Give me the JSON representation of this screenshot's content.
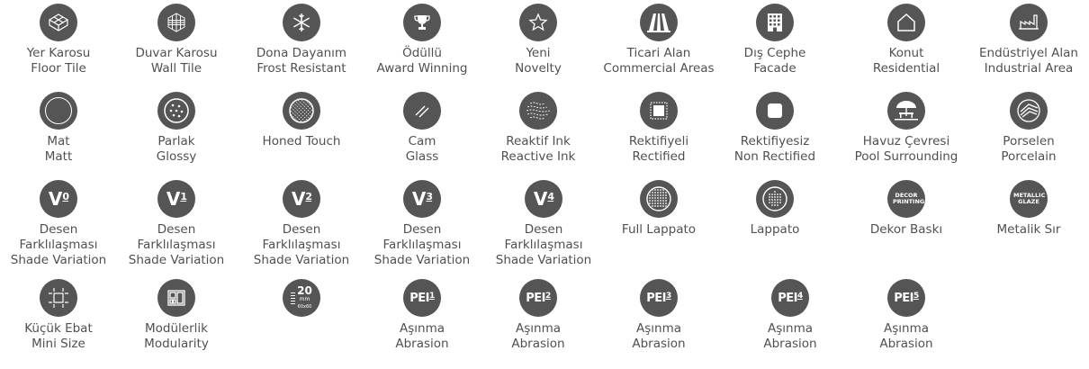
{
  "items": [
    {
      "name": "floor-tile",
      "icon": "floor-tile-icon",
      "l1": "Yer Karosu",
      "l2": "Floor Tile"
    },
    {
      "name": "wall-tile",
      "icon": "wall-tile-icon",
      "l1": "Duvar Karosu",
      "l2": "Wall Tile"
    },
    {
      "name": "frost-resistant",
      "icon": "snowflake-icon",
      "l1": "Dona Dayanım",
      "l2": "Frost Resistant"
    },
    {
      "name": "award-winning",
      "icon": "trophy-icon",
      "l1": "Ödüllü",
      "l2": "Award Winning"
    },
    {
      "name": "novelty",
      "icon": "star-icon",
      "l1": "Yeni",
      "l2": "Novelty"
    },
    {
      "name": "commercial-areas",
      "icon": "commercial-area-icon",
      "l1": "Ticari Alan",
      "l2": "Commercial Areas"
    },
    {
      "name": "facade",
      "icon": "building-icon",
      "l1": "Dış Cephe",
      "l2": "Facade"
    },
    {
      "name": "residential",
      "icon": "house-icon",
      "l1": "Konut",
      "l2": "Residential"
    },
    {
      "name": "industrial-area",
      "icon": "factory-icon",
      "l1": "Endüstriyel Alan",
      "l2": "Industrial Area"
    },
    {
      "name": "matt",
      "icon": "matt-icon",
      "l1": "Mat",
      "l2": "Matt"
    },
    {
      "name": "glossy",
      "icon": "glossy-icon",
      "l1": "Parlak",
      "l2": "Glossy"
    },
    {
      "name": "honed-touch",
      "icon": "honed-touch-icon",
      "l1": "Honed Touch",
      "l2": ""
    },
    {
      "name": "glass",
      "icon": "glass-icon",
      "l1": "Cam",
      "l2": "Glass"
    },
    {
      "name": "reactive-ink",
      "icon": "reactive-ink-icon",
      "l1": "Reaktif Ink",
      "l2": "Reactive Ink"
    },
    {
      "name": "rectified",
      "icon": "rectified-icon",
      "l1": "Rektifiyeli",
      "l2": "Rectified"
    },
    {
      "name": "non-rectified",
      "icon": "non-rectified-icon",
      "l1": "Rektifiyesiz",
      "l2": "Non Rectified"
    },
    {
      "name": "pool-surrounding",
      "icon": "pool-umbrella-icon",
      "l1": "Havuz Çevresi",
      "l2": "Pool Surrounding"
    },
    {
      "name": "porcelain",
      "icon": "porcelain-icon",
      "l1": "Porselen",
      "l2": "Porcelain"
    },
    {
      "name": "shade-variation-v0",
      "icon": "v0-icon",
      "badge": "V",
      "num": "0",
      "l1": "Desen",
      "l2": "Farklılaşması",
      "l3": "Shade Variation"
    },
    {
      "name": "shade-variation-v1",
      "icon": "v1-icon",
      "badge": "V",
      "num": "1",
      "l1": "Desen",
      "l2": "Farklılaşması",
      "l3": "Shade Variation"
    },
    {
      "name": "shade-variation-v2",
      "icon": "v2-icon",
      "badge": "V",
      "num": "2",
      "l1": "Desen",
      "l2": "Farklılaşması",
      "l3": "Shade Variation"
    },
    {
      "name": "shade-variation-v3",
      "icon": "v3-icon",
      "badge": "V",
      "num": "3",
      "l1": "Desen",
      "l2": "Farklılaşması",
      "l3": "Shade Variation"
    },
    {
      "name": "shade-variation-v4",
      "icon": "v4-icon",
      "badge": "V",
      "num": "4",
      "l1": "Desen",
      "l2": "Farklılaşması",
      "l3": "Shade Variation"
    },
    {
      "name": "full-lappato",
      "icon": "full-lappato-icon",
      "l1": "Full Lappato",
      "l2": ""
    },
    {
      "name": "lappato",
      "icon": "lappato-icon",
      "l1": "Lappato",
      "l2": ""
    },
    {
      "name": "decor-printing",
      "icon": "decor-printing-icon",
      "badge": "DECOR PRINTING",
      "l1": "Dekor Baskı",
      "l2": ""
    },
    {
      "name": "metallic-glaze",
      "icon": "metallic-glaze-icon",
      "badge": "METALLIC GLAZE",
      "l1": "Metalik Sır",
      "l2": ""
    },
    {
      "name": "mini-size",
      "icon": "mini-size-icon",
      "l1": "Küçük Ebat",
      "l2": "Mini Size"
    },
    {
      "name": "modularity",
      "icon": "modularity-icon",
      "l1": "Modülerlik",
      "l2": "Modularity"
    },
    {
      "name": "thickness",
      "icon": "thickness-icon",
      "badge": "20",
      "unit": "mm",
      "size": "60x60",
      "l1": "",
      "l2": ""
    },
    {
      "name": "abrasion-pei1",
      "icon": "pei1-icon",
      "badge": "PEI",
      "num": "1",
      "l1": "Aşınma",
      "l2": "Abrasion"
    },
    {
      "name": "abrasion-pei2",
      "icon": "pei2-icon",
      "badge": "PEI",
      "num": "2",
      "l1": "Aşınma",
      "l2": "Abrasion"
    },
    {
      "name": "abrasion-pei3",
      "icon": "pei3-icon",
      "badge": "PEI",
      "num": "3",
      "l1": "Aşınma",
      "l2": "Abrasion"
    },
    {
      "name": "abrasion-pei4",
      "icon": "pei4-icon",
      "badge": "PEI",
      "num": "4",
      "l1": "Aşınma",
      "l2": "Abrasion"
    },
    {
      "name": "abrasion-pei5",
      "icon": "pei5-icon",
      "badge": "PEI",
      "num": "5",
      "l1": "Aşınma",
      "l2": "Abrasion"
    }
  ]
}
